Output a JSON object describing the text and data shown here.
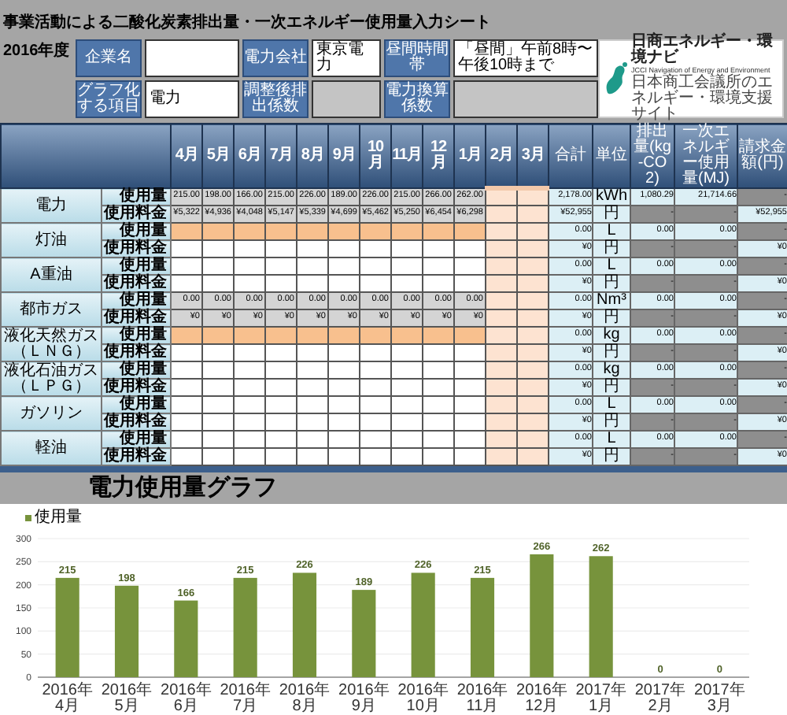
{
  "title": "事業活動による二酸化炭素排出量・一次エネルギー使用量入力シート",
  "fiscal_year": "2016年度",
  "fields": [
    [
      {
        "label": "企業名",
        "kind": "input"
      },
      {
        "label": "電力会社",
        "value": "東京電力",
        "kind": "input"
      },
      {
        "label": "昼間時間帯",
        "value": "「昼間」午前8時〜午後10時まで",
        "kind": "input"
      }
    ],
    [
      {
        "label": "グラフ化する項目",
        "value": "電力",
        "kind": "input"
      },
      {
        "label": "調整後排出係数",
        "kind": "computed"
      },
      {
        "label": "電力換算係数",
        "kind": "computed"
      }
    ]
  ],
  "logo": {
    "name": "日商エネルギー・環境ナビ",
    "tagline": "JCCI Navigation of Energy and Environment",
    "subtitle": "日本商工会議所のエネルギー・環境支援サイト"
  },
  "table": {
    "month_columns": [
      {
        "label": "4月",
        "pending": false
      },
      {
        "label": "5月",
        "pending": false
      },
      {
        "label": "6月",
        "pending": false
      },
      {
        "label": "7月",
        "pending": false
      },
      {
        "label": "8月",
        "pending": false
      },
      {
        "label": "9月",
        "pending": false
      },
      {
        "label": "10月",
        "pending": false
      },
      {
        "label": "11月",
        "pending": false
      },
      {
        "label": "12月",
        "pending": false
      },
      {
        "label": "1月",
        "pending": false
      },
      {
        "label": "2月",
        "pending": true
      },
      {
        "label": "3月",
        "pending": true
      }
    ],
    "summary_columns": [
      "合計",
      "単位",
      "排出量(kg-CO2)",
      "一次エネルギー使用量(MJ)",
      "請求金額(円)"
    ],
    "fuels": [
      {
        "name": "電力",
        "lines": [
          {
            "label": "使用量",
            "kind": "computed",
            "values": [
              "215.00",
              "198.00",
              "166.00",
              "215.00",
              "226.00",
              "189.00",
              "226.00",
              "215.00",
              "266.00",
              "262.00"
            ],
            "summary": [
              {
                "text": "2,178.00",
                "shaded": false
              },
              {
                "text": "kWh",
                "shaded": false
              },
              {
                "text": "1,080.29",
                "shaded": false
              },
              {
                "text": "21,714.66",
                "shaded": false
              },
              {
                "text": "-",
                "shaded": true
              }
            ]
          },
          {
            "label": "使用料金",
            "kind": "computed",
            "values": [
              "¥5,322",
              "¥4,936",
              "¥4,048",
              "¥5,147",
              "¥5,339",
              "¥4,699",
              "¥5,462",
              "¥5,250",
              "¥6,454",
              "¥6,298"
            ],
            "summary": [
              {
                "text": "¥52,955",
                "shaded": false
              },
              {
                "text": "円",
                "shaded": false
              },
              {
                "text": "-",
                "shaded": true
              },
              {
                "text": "-",
                "shaded": true
              },
              {
                "text": "¥52,955",
                "shaded": false
              }
            ]
          }
        ]
      },
      {
        "name": "灯油",
        "lines": [
          {
            "label": "使用量",
            "kind": "highlight",
            "summary": [
              {
                "text": "0.00",
                "shaded": false
              },
              {
                "text": "L",
                "shaded": false
              },
              {
                "text": "0.00",
                "shaded": false
              },
              {
                "text": "0.00",
                "shaded": false
              },
              {
                "text": "-",
                "shaded": true
              }
            ]
          },
          {
            "label": "使用料金",
            "kind": "input",
            "summary": [
              {
                "text": "¥0",
                "shaded": false
              },
              {
                "text": "円",
                "shaded": false
              },
              {
                "text": "-",
                "shaded": true
              },
              {
                "text": "-",
                "shaded": true
              },
              {
                "text": "¥0",
                "shaded": false
              }
            ]
          }
        ]
      },
      {
        "name": "A重油",
        "lines": [
          {
            "label": "使用量",
            "kind": "input",
            "summary": [
              {
                "text": "0.00",
                "shaded": false
              },
              {
                "text": "L",
                "shaded": false
              },
              {
                "text": "0.00",
                "shaded": false
              },
              {
                "text": "0.00",
                "shaded": false
              },
              {
                "text": "-",
                "shaded": true
              }
            ]
          },
          {
            "label": "使用料金",
            "kind": "input",
            "summary": [
              {
                "text": "¥0",
                "shaded": false
              },
              {
                "text": "円",
                "shaded": false
              },
              {
                "text": "-",
                "shaded": true
              },
              {
                "text": "-",
                "shaded": true
              },
              {
                "text": "¥0",
                "shaded": false
              }
            ]
          }
        ]
      },
      {
        "name": "都市ガス",
        "lines": [
          {
            "label": "使用量",
            "kind": "computed",
            "values": [
              "0.00",
              "0.00",
              "0.00",
              "0.00",
              "0.00",
              "0.00",
              "0.00",
              "0.00",
              "0.00",
              "0.00"
            ],
            "summary": [
              {
                "text": "0.00",
                "shaded": false
              },
              {
                "text": "Nm³",
                "shaded": false
              },
              {
                "text": "0.00",
                "shaded": false
              },
              {
                "text": "0.00",
                "shaded": false
              },
              {
                "text": "-",
                "shaded": true
              }
            ]
          },
          {
            "label": "使用料金",
            "kind": "computed",
            "values": [
              "¥0",
              "¥0",
              "¥0",
              "¥0",
              "¥0",
              "¥0",
              "¥0",
              "¥0",
              "¥0",
              "¥0"
            ],
            "summary": [
              {
                "text": "¥0",
                "shaded": false
              },
              {
                "text": "円",
                "shaded": false
              },
              {
                "text": "-",
                "shaded": true
              },
              {
                "text": "-",
                "shaded": true
              },
              {
                "text": "¥0",
                "shaded": false
              }
            ]
          }
        ]
      },
      {
        "name": "液化天然ガス（ＬＮＧ）",
        "lines": [
          {
            "label": "使用量",
            "kind": "highlight",
            "summary": [
              {
                "text": "0.00",
                "shaded": false
              },
              {
                "text": "kg",
                "shaded": false
              },
              {
                "text": "0.00",
                "shaded": false
              },
              {
                "text": "0.00",
                "shaded": false
              },
              {
                "text": "-",
                "shaded": true
              }
            ]
          },
          {
            "label": "使用料金",
            "kind": "input",
            "summary": [
              {
                "text": "¥0",
                "shaded": false
              },
              {
                "text": "円",
                "shaded": false
              },
              {
                "text": "-",
                "shaded": true
              },
              {
                "text": "-",
                "shaded": true
              },
              {
                "text": "¥0",
                "shaded": false
              }
            ]
          }
        ]
      },
      {
        "name": "液化石油ガス（ＬＰＧ）",
        "lines": [
          {
            "label": "使用量",
            "kind": "input",
            "summary": [
              {
                "text": "0.00",
                "shaded": false
              },
              {
                "text": "kg",
                "shaded": false
              },
              {
                "text": "0.00",
                "shaded": false
              },
              {
                "text": "0.00",
                "shaded": false
              },
              {
                "text": "-",
                "shaded": true
              }
            ]
          },
          {
            "label": "使用料金",
            "kind": "input",
            "summary": [
              {
                "text": "¥0",
                "shaded": false
              },
              {
                "text": "円",
                "shaded": false
              },
              {
                "text": "-",
                "shaded": true
              },
              {
                "text": "-",
                "shaded": true
              },
              {
                "text": "¥0",
                "shaded": false
              }
            ]
          }
        ]
      },
      {
        "name": "ガソリン",
        "lines": [
          {
            "label": "使用量",
            "kind": "input",
            "summary": [
              {
                "text": "0.00",
                "shaded": false
              },
              {
                "text": "L",
                "shaded": false
              },
              {
                "text": "0.00",
                "shaded": false
              },
              {
                "text": "0.00",
                "shaded": false
              },
              {
                "text": "-",
                "shaded": true
              }
            ]
          },
          {
            "label": "使用料金",
            "kind": "input",
            "summary": [
              {
                "text": "¥0",
                "shaded": false
              },
              {
                "text": "円",
                "shaded": false
              },
              {
                "text": "-",
                "shaded": true
              },
              {
                "text": "-",
                "shaded": true
              },
              {
                "text": "¥0",
                "shaded": false
              }
            ]
          }
        ]
      },
      {
        "name": "軽油",
        "lines": [
          {
            "label": "使用量",
            "kind": "input",
            "summary": [
              {
                "text": "0.00",
                "shaded": false
              },
              {
                "text": "L",
                "shaded": false
              },
              {
                "text": "0.00",
                "shaded": false
              },
              {
                "text": "0.00",
                "shaded": false
              },
              {
                "text": "-",
                "shaded": true
              }
            ]
          },
          {
            "label": "使用料金",
            "kind": "input",
            "summary": [
              {
                "text": "¥0",
                "shaded": false
              },
              {
                "text": "円",
                "shaded": false
              },
              {
                "text": "-",
                "shaded": true
              },
              {
                "text": "-",
                "shaded": true
              },
              {
                "text": "¥0",
                "shaded": false
              }
            ]
          }
        ]
      }
    ]
  },
  "graph": {
    "heading": "電力使用量グラフ",
    "chart_data": {
      "type": "bar",
      "categories": [
        "2016年4月",
        "2016年5月",
        "2016年6月",
        "2016年7月",
        "2016年8月",
        "2016年9月",
        "2016年10月",
        "2016年11月",
        "2016年12月",
        "2017年1月",
        "2017年2月",
        "2017年3月"
      ],
      "series": [
        {
          "name": "使用量",
          "color": "#77933c",
          "values": [
            215,
            198,
            166,
            215,
            226,
            189,
            226,
            215,
            266,
            262,
            0,
            0
          ]
        }
      ],
      "ylim": [
        0,
        300
      ],
      "yticks": [
        0,
        50,
        100,
        150,
        200,
        250,
        300
      ],
      "grid": true,
      "data_labels": true
    }
  }
}
